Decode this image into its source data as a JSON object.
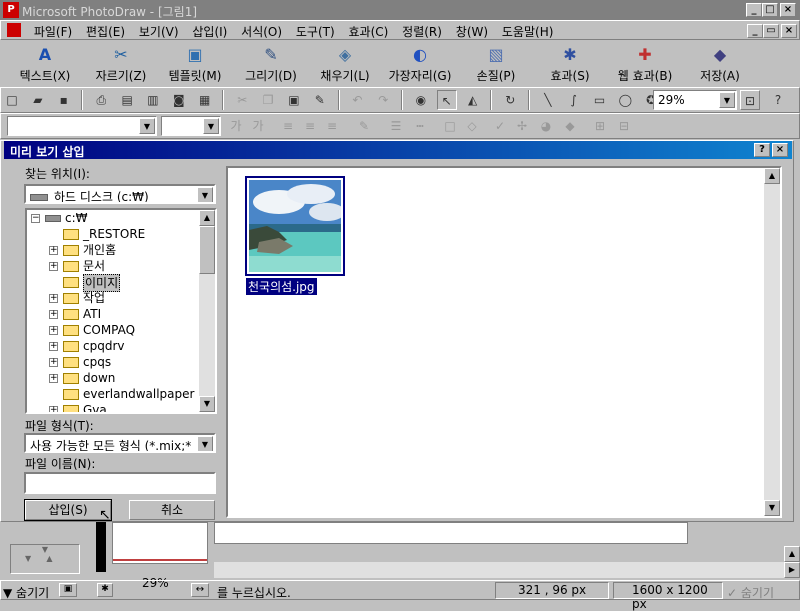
{
  "app": {
    "title": "Microsoft PhotoDraw - [그림1]",
    "app_icon": "photodraw-icon"
  },
  "menu": [
    "파일(F)",
    "편집(E)",
    "보기(V)",
    "삽입(I)",
    "서식(O)",
    "도구(T)",
    "효과(C)",
    "정렬(R)",
    "창(W)",
    "도움말(H)"
  ],
  "big_toolbar": [
    {
      "label": "텍스트(X)",
      "icon": "text-icon"
    },
    {
      "label": "자르기(Z)",
      "icon": "scissors-icon"
    },
    {
      "label": "템플릿(M)",
      "icon": "template-icon"
    },
    {
      "label": "그리기(D)",
      "icon": "brush-icon"
    },
    {
      "label": "채우기(L)",
      "icon": "fill-bucket-icon"
    },
    {
      "label": "가장자리(G)",
      "icon": "edge-icon"
    },
    {
      "label": "손질(P)",
      "icon": "touchup-icon"
    },
    {
      "label": "효과(S)",
      "icon": "effects-icon"
    },
    {
      "label": "웹 효과(B)",
      "icon": "web-effects-icon"
    },
    {
      "label": "저장(A)",
      "icon": "save-disk-icon"
    }
  ],
  "zoom": "29%",
  "dialog": {
    "title": "미리 보기 삽입",
    "help": "?",
    "close": "×",
    "look_in_label": "찾는 위치(I):",
    "look_in_value": "하드 디스크 (c:₩)",
    "tree": [
      {
        "label": "c:₩",
        "level": 0,
        "expander": "−"
      },
      {
        "label": "_RESTORE",
        "level": 1,
        "expander": ""
      },
      {
        "label": "개인홈",
        "level": 1,
        "expander": "+"
      },
      {
        "label": "문서",
        "level": 1,
        "expander": "+"
      },
      {
        "label": "이미지",
        "level": 1,
        "expander": "",
        "selected": true
      },
      {
        "label": "작업",
        "level": 1,
        "expander": "+"
      },
      {
        "label": "ATI",
        "level": 1,
        "expander": "+"
      },
      {
        "label": "COMPAQ",
        "level": 1,
        "expander": "+"
      },
      {
        "label": "cpqdrv",
        "level": 1,
        "expander": "+"
      },
      {
        "label": "cpqs",
        "level": 1,
        "expander": "+"
      },
      {
        "label": "down",
        "level": 1,
        "expander": "+"
      },
      {
        "label": "everlandwallpaper",
        "level": 1,
        "expander": ""
      },
      {
        "label": "Gva",
        "level": 1,
        "expander": "+"
      }
    ],
    "file_type_label": "파일 형식(T):",
    "file_type_value": "사용 가능한 모든 형식 (*.mix;*",
    "file_name_label": "파일 이름(N):",
    "file_name_value": "",
    "insert_button": "삽입(S)",
    "cancel_button": "취소",
    "preview_file": "천국의섬.jpg"
  },
  "lower": {
    "zoom_label": "29%",
    "hide_label": "숨기기",
    "status_text": "를 누르십시오.",
    "coords": "321 , 96  px",
    "size": "1600 x 1200  px",
    "hide_right": "숨기기"
  },
  "colors": {
    "title_active": "#000080",
    "title_inactive": "#808080",
    "face": "#c0c0c0"
  }
}
